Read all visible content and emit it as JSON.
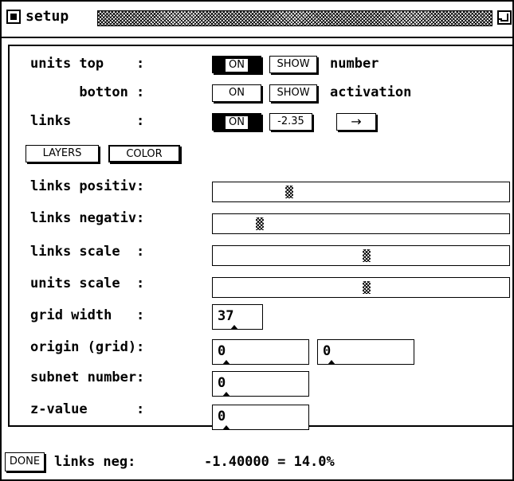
{
  "window": {
    "title": "setup"
  },
  "rows": {
    "units_top": {
      "label": "units top    :",
      "on": "ON",
      "show": "SHOW",
      "text": "number"
    },
    "units_bottom": {
      "label": "      botton :",
      "on": "ON",
      "show": "SHOW",
      "text": "activation"
    },
    "links": {
      "label": "links        :",
      "on": "ON",
      "value": "-2.35",
      "arrow": "→"
    }
  },
  "buttons": {
    "layers": "LAYERS",
    "color": "COLOR",
    "done": "DONE"
  },
  "sliders": [
    {
      "label": "links positiv:",
      "level": 0.25
    },
    {
      "label": "links negativ:",
      "level": 0.15
    },
    {
      "label": "links scale  :",
      "level": 0.52
    },
    {
      "label": "units scale  :",
      "level": 0.52
    }
  ],
  "fields": {
    "grid_width": {
      "label": "grid width   :",
      "value": "37"
    },
    "origin": {
      "label": "origin (grid):",
      "x": "0",
      "y": "0"
    },
    "subnet": {
      "label": "subnet number:",
      "value": "0"
    },
    "zvalue": {
      "label": "z-value      :",
      "value": "0"
    }
  },
  "status": {
    "label": "links neg:",
    "value": "-1.40000 = 14.0%"
  }
}
